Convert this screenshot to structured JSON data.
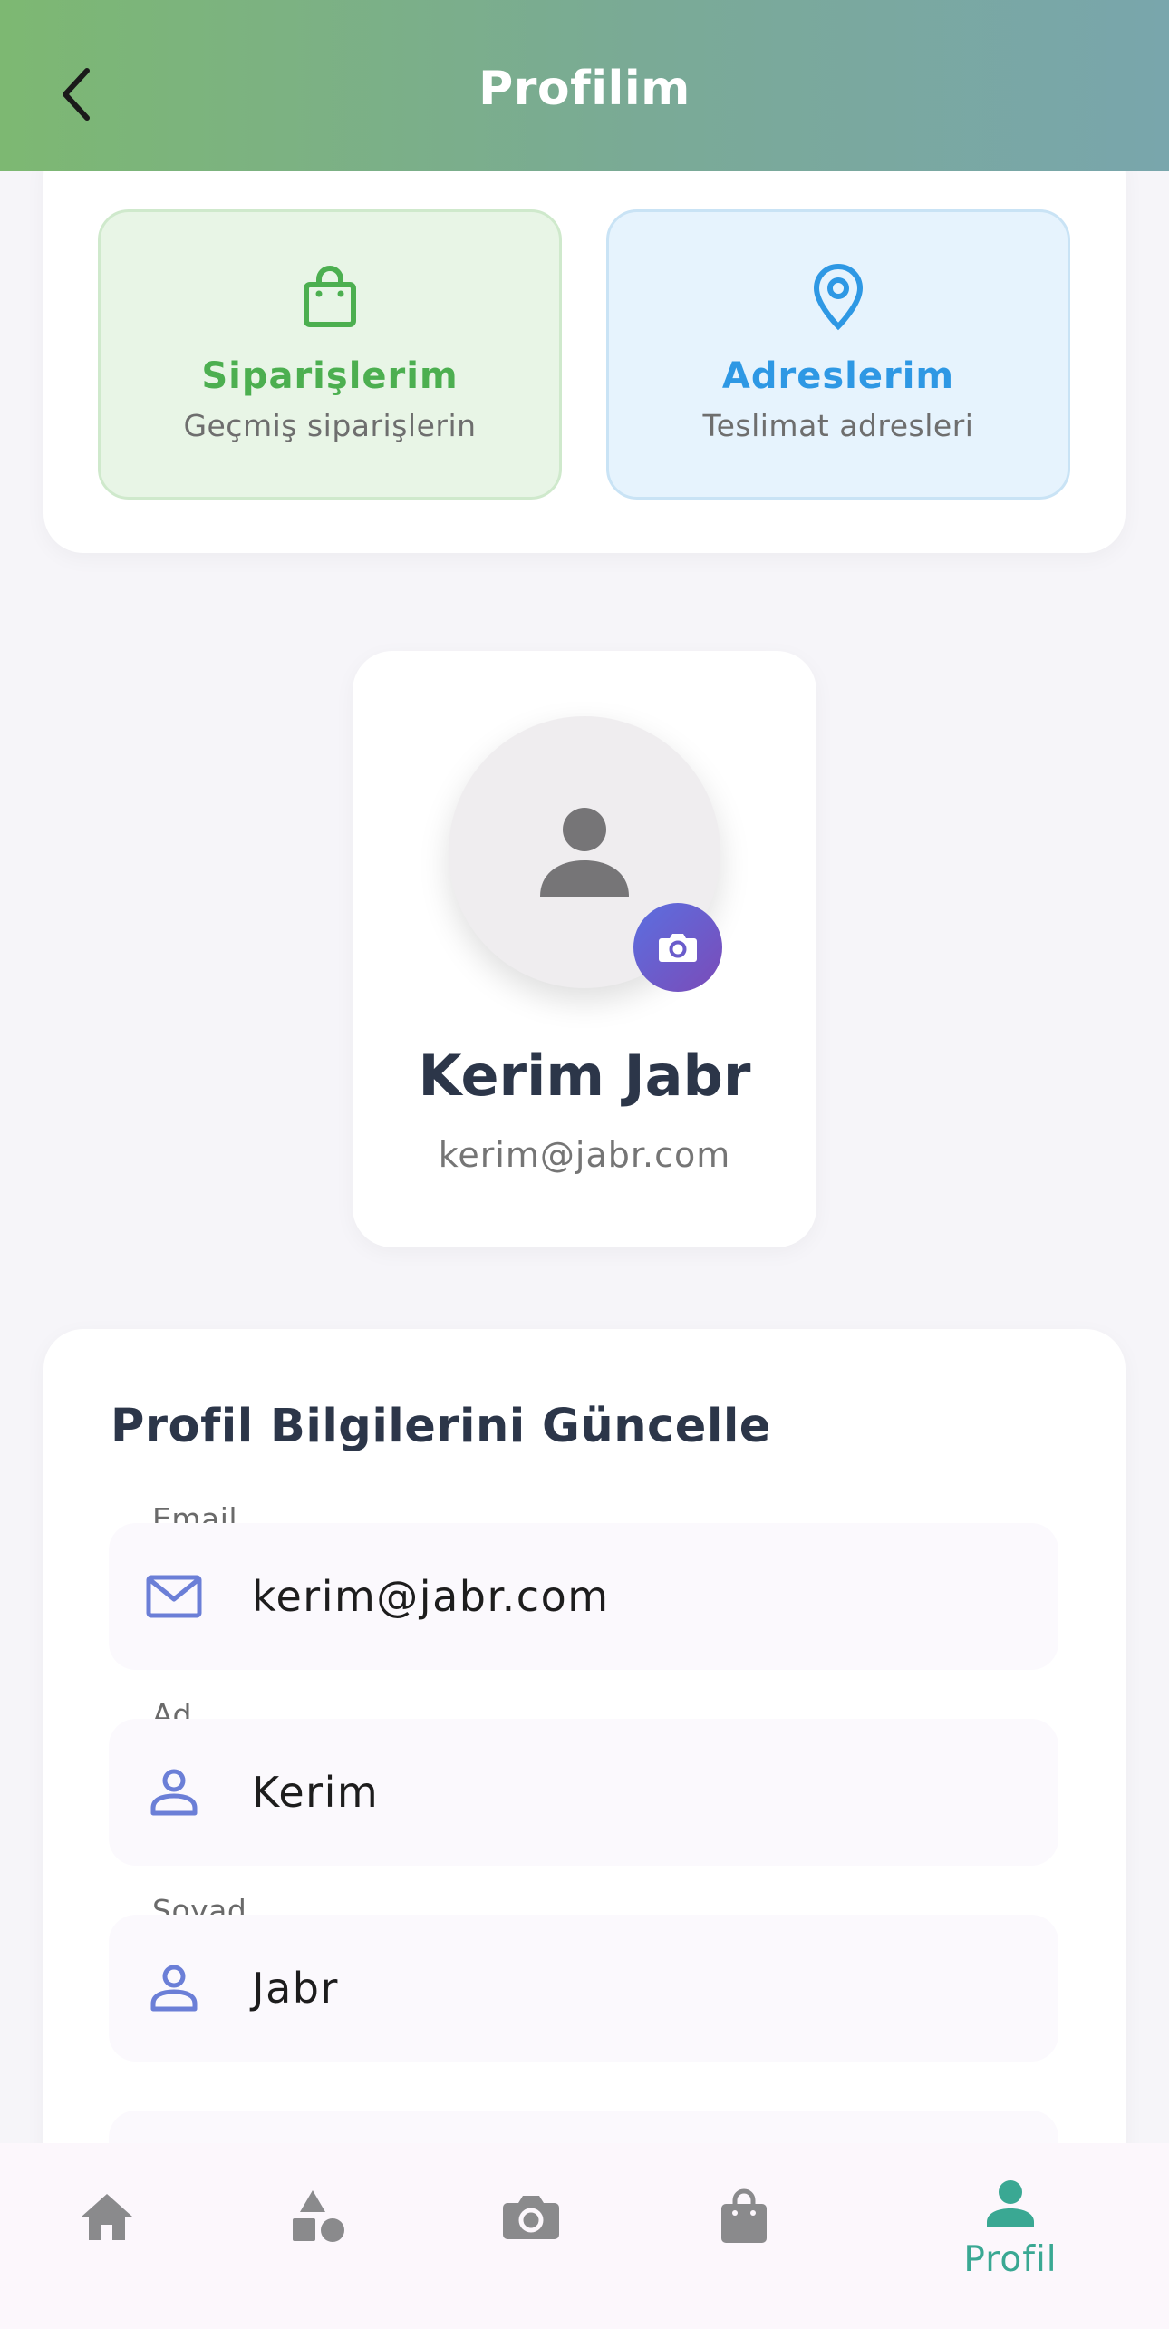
{
  "header": {
    "title": "Profilim"
  },
  "quick_actions": [
    {
      "title": "Siparişlerim",
      "subtitle": "Geçmiş siparişlerin",
      "icon": "shopping-bag-icon",
      "color": "#4caf50"
    },
    {
      "title": "Adreslerim",
      "subtitle": "Teslimat adresleri",
      "icon": "location-pin-icon",
      "color": "#2e98e4"
    }
  ],
  "profile": {
    "name": "Kerim Jabr",
    "email": "kerim@jabr.com"
  },
  "form": {
    "title": "Profil Bilgilerini Güncelle",
    "fields": [
      {
        "label": "Email",
        "value": "kerim@jabr.com",
        "icon": "mail-icon"
      },
      {
        "label": "Ad",
        "value": "Kerim",
        "icon": "person-icon"
      },
      {
        "label": "Soyad",
        "value": "Jabr",
        "icon": "person-icon"
      }
    ]
  },
  "bottom_nav": {
    "items": [
      {
        "icon": "home-icon",
        "label": ""
      },
      {
        "icon": "categories-icon",
        "label": ""
      },
      {
        "icon": "camera-icon",
        "label": ""
      },
      {
        "icon": "shopping-bag-icon",
        "label": ""
      },
      {
        "icon": "person-icon",
        "label": "Profil",
        "active": true
      }
    ]
  },
  "colors": {
    "accent": "#3aa893",
    "header_start": "#7db872",
    "header_end": "#79a6ac",
    "field_icon": "#6b7fd7"
  }
}
